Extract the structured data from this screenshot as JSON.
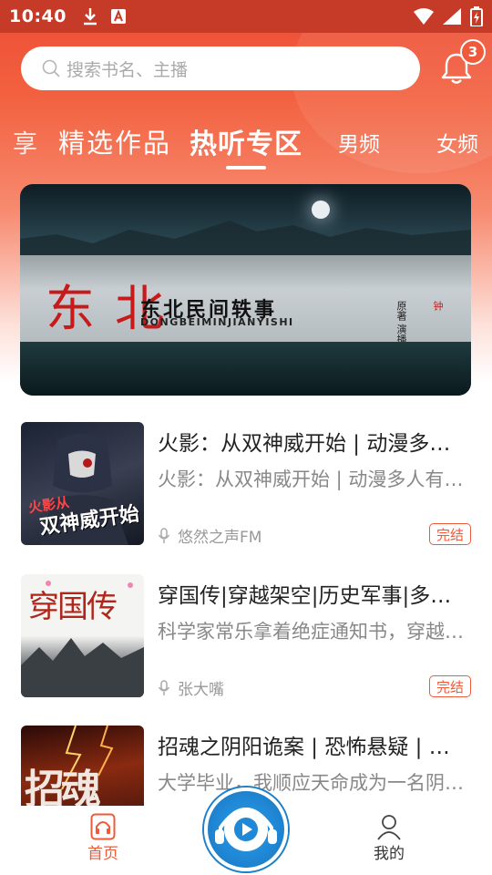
{
  "status_bar": {
    "time": "10:40"
  },
  "search": {
    "placeholder": "搜索书名、主播"
  },
  "notifications": {
    "count": "3"
  },
  "tabs": [
    {
      "label": "享"
    },
    {
      "label": "精选作品"
    },
    {
      "label": "热听专区",
      "active": true
    },
    {
      "label": "男频"
    },
    {
      "label": "女频"
    }
  ],
  "banner": {
    "big_text": "东北",
    "title": "东北民间轶事",
    "pinyin": "DONGBEIMINJIANYISHI",
    "credit": "原著 演播",
    "seal": "钟"
  },
  "items": [
    {
      "title": "火影：从双神威开始 | 动漫多人有声剧",
      "desc": "火影：从双神威开始 | 动漫多人有声剧",
      "author": "悠然之声FM",
      "status": "完结",
      "cover_text": "双神威开始",
      "cover_sub": "火影从"
    },
    {
      "title": "穿国传|穿越架空|历史军事|多人有声剧",
      "desc": "科学家常乐拿着绝症通知书，穿越到了古代",
      "author": "张大嘴",
      "status": "完结",
      "cover_text": "穿国传"
    },
    {
      "title": "招魂之阴阳诡案 | 恐怖悬疑 | 多人有声剧",
      "desc": "大学毕业，我顺应天命成为一名阴阳先生",
      "author": "",
      "status": "",
      "cover_text": "招魂"
    }
  ],
  "bottom_nav": {
    "home": "首页",
    "mine": "我的"
  },
  "colors": {
    "accent": "#ef5a3a",
    "header": "#ec4c35",
    "play": "#2088d6"
  }
}
